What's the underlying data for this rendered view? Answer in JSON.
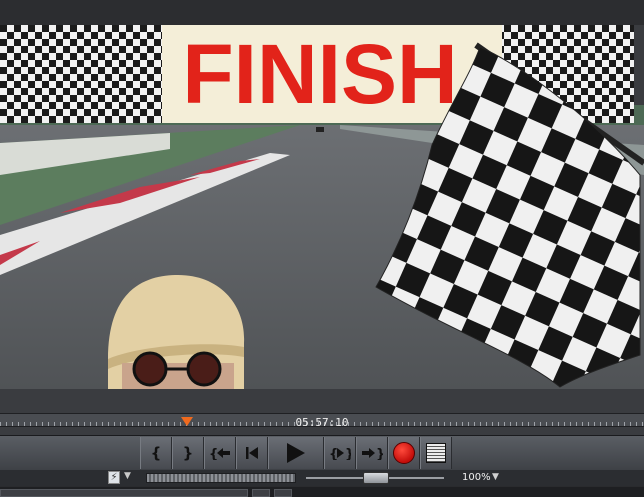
{
  "video": {
    "banner_text": "FINISH",
    "colors": {
      "banner_red": "#e2231a",
      "banner_bg": "#f4eed8",
      "checker_dark": "#1b1b1b",
      "checker_light": "#f2f2f2",
      "track_asphalt": "#5f6266",
      "kerb_red": "#c4394a"
    }
  },
  "timeline": {
    "timecode": "05:57:10",
    "playhead_color": "#f06a1e"
  },
  "transport": {
    "mark_in_icon": "{",
    "mark_out_icon": "}",
    "buttons": [
      {
        "name": "mark-in-icon"
      },
      {
        "name": "mark-out-icon"
      },
      {
        "name": "go-to-mark-in-icon"
      },
      {
        "name": "skip-to-start-icon"
      },
      {
        "name": "play-icon"
      },
      {
        "name": "go-to-mark-out-icon"
      },
      {
        "name": "skip-to-end-icon"
      },
      {
        "name": "record-icon"
      },
      {
        "name": "list-icon"
      }
    ],
    "record_color": "#d4130f"
  },
  "bottom": {
    "snap_icon": "lightning-icon",
    "zoom_label": "100%",
    "zoom_caret": "▼",
    "snap_caret": "▼"
  }
}
